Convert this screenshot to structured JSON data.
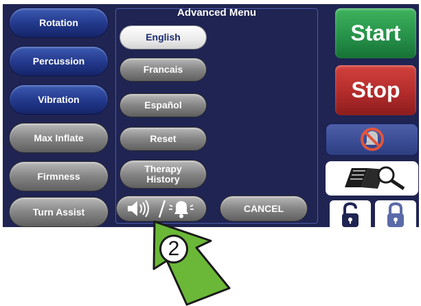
{
  "left_buttons": [
    {
      "label": "Rotation",
      "style": "blue"
    },
    {
      "label": "Percussion",
      "style": "blue"
    },
    {
      "label": "Vibration",
      "style": "blue"
    },
    {
      "label": "Max Inflate",
      "style": "gray"
    },
    {
      "label": "Firmness",
      "style": "gray"
    },
    {
      "label": "Turn Assist",
      "style": "gray"
    }
  ],
  "advanced_menu": {
    "title": "Advanced Menu",
    "items": [
      {
        "label": "English",
        "selected": true
      },
      {
        "label": "Francais",
        "selected": false
      },
      {
        "label": "Español",
        "selected": false
      },
      {
        "label": "Reset",
        "selected": false
      },
      {
        "label": "Therapy History",
        "selected": false
      }
    ],
    "sound_toggle_icons": [
      "speaker-icon",
      "bell-icon"
    ],
    "cancel_label": "CANCEL"
  },
  "right_panel": {
    "start_label": "Start",
    "stop_label": "Stop",
    "icons": [
      "no-alarm-icon",
      "manual-search-icon",
      "unlock-icon",
      "lock-icon"
    ]
  },
  "callout": {
    "number": "2",
    "arrow_icon": "up-arrow-icon"
  },
  "colors": {
    "screen_background": "#1f2452",
    "start_green": "#26924a",
    "stop_red": "#b32b2b",
    "callout_arrow_green": "#6bb838"
  }
}
